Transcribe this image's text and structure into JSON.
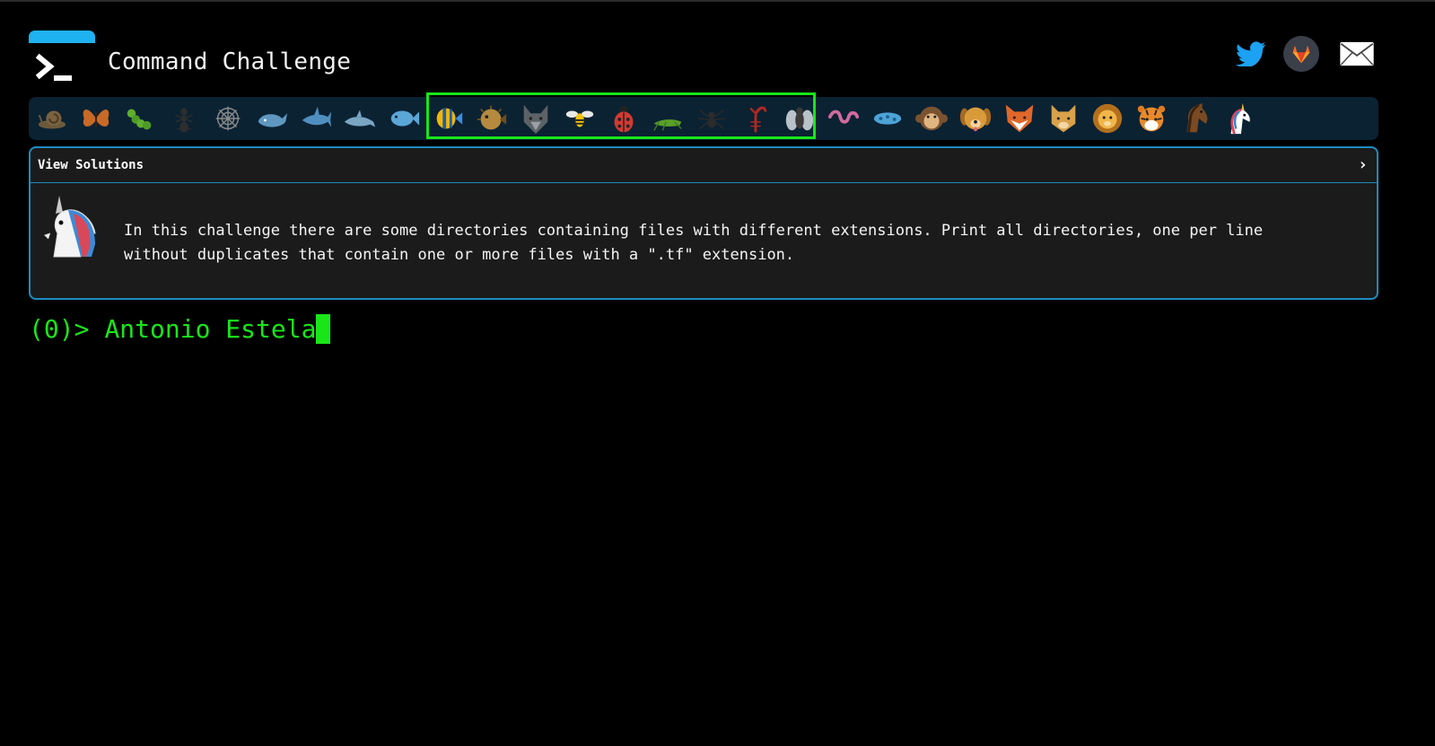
{
  "app": {
    "title": "Command Challenge"
  },
  "social": {
    "twitter": "twitter-icon",
    "gitlab": "gitlab-icon",
    "mail": "mail-icon"
  },
  "levels": [
    "snail",
    "butterfly",
    "caterpillar",
    "ant",
    "spider-web",
    "whale",
    "shark",
    "dolphin",
    "fish",
    "tropical-fish",
    "blowfish",
    "wolf",
    "bee",
    "ladybug",
    "cricket",
    "spider",
    "scorpion",
    "fly",
    "worm",
    "microbe",
    "monkey",
    "dog",
    "fox",
    "cat",
    "lion",
    "tiger",
    "horse",
    "unicorn"
  ],
  "highlight_note": "levels 10-18 outlined in green",
  "panel": {
    "title": "View Solutions",
    "description": "In this challenge there are some directories containing files with different extensions. Print all directories, one per line\nwithout duplicates that contain one or more files with a \".tf\" extension."
  },
  "prompt": {
    "prefix": "(0)>",
    "input": "Antonio Estela"
  },
  "colors": {
    "accent": "#19e619",
    "brand": "#1fb2f0",
    "panel_border": "#1d8cbf",
    "bar_bg": "#0b2233"
  }
}
